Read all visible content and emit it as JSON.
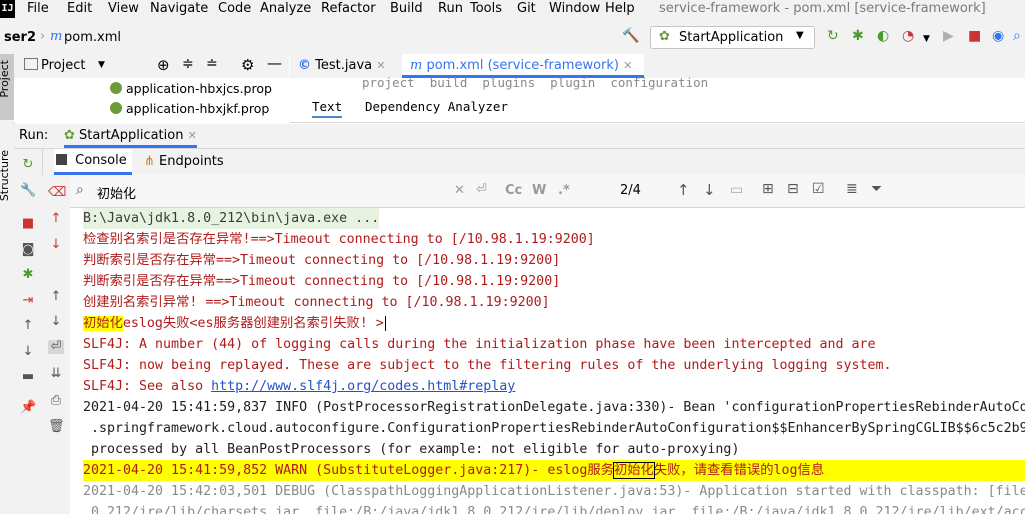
{
  "app": {
    "logo": "IJ",
    "window_title": "service-framework - pom.xml [service-framework]"
  },
  "menu": [
    "File",
    "Edit",
    "View",
    "Navigate",
    "Code",
    "Analyze",
    "Refactor",
    "Build",
    "Run",
    "Tools",
    "Git",
    "Window",
    "Help"
  ],
  "navbar": {
    "project_crumb": "ser2",
    "file_crumb": "pom.xml",
    "run_config": "StartApplication"
  },
  "left_strip": {
    "project_label": "Project",
    "structure_label": "Structure"
  },
  "project_panel": {
    "title": "Project",
    "files": [
      "application-hbxjcs.prop",
      "application-hbxjkf.prop"
    ]
  },
  "editor": {
    "tabs": [
      "Test.java",
      "pom.xml (service-framework)"
    ],
    "breadcrumbs": "project  build  plugins  plugin  configuration",
    "subtabs": [
      "Text",
      "Dependency Analyzer"
    ]
  },
  "run_panel": {
    "label": "Run:",
    "tab": "StartApplication",
    "tabs": [
      "Console",
      "Endpoints"
    ]
  },
  "search": {
    "value": "初始化",
    "match_count": "2/4",
    "case_label": "Cc",
    "word_label": "W",
    "regex_label": ".*"
  },
  "console": {
    "lines": [
      {
        "text": "B:\\Java\\jdk1.8.0_212\\bin\\java.exe ...",
        "style": "c-gray"
      },
      {
        "text": "检查别名索引是否存在异常!==>Timeout connecting to [/10.98.1.19:9200]",
        "style": "c-red"
      },
      {
        "text": "判断索引是否存在异常==>Timeout connecting to [/10.98.1.19:9200]",
        "style": "c-red"
      },
      {
        "text": "判断索引是否存在异常==>Timeout connecting to [/10.98.1.19:9200]",
        "style": "c-red"
      },
      {
        "text": "创建别名索引异常! ==>Timeout connecting to [/10.98.1.19:9200]",
        "style": "c-red"
      },
      {
        "text_hl": "初始化",
        "text": "eslog失败<es服务器创建别名索引失败! >",
        "style": "c-red"
      },
      {
        "text": "SLF4J: A number (44) of logging calls during the initialization phase have been intercepted and are",
        "style": "c-red"
      },
      {
        "text": "SLF4J: now being replayed. These are subject to the filtering rules of the underlying logging system.",
        "style": "c-red"
      },
      {
        "text": "SLF4J: See also ",
        "link": "http://www.slf4j.org/codes.html#replay",
        "style": "c-red"
      },
      {
        "text": "2021-04-20 15:41:59,837 INFO (PostProcessorRegistrationDelegate.java:330)- Bean 'configurationPropertiesRebinderAutoCo",
        "style": "c-black"
      },
      {
        "text": " .springframework.cloud.autoconfigure.ConfigurationPropertiesRebinderAutoConfiguration$$EnhancerBySpringCGLIB$$6c5c2b9",
        "style": "c-black"
      },
      {
        "text": " processed by all BeanPostProcessors (for example: not eligible for auto-proxying)",
        "style": "c-black"
      },
      {
        "pre": "2021-04-20 15:41:59,852 WARN (SubstituteLogger.java:217)- eslog服务",
        "text_hl": "初始化",
        "text": "失败，请查看错误的log信息",
        "style": "c-red"
      },
      {
        "text": "2021-04-20 15:42:03,501 DEBUG (ClasspathLoggingApplicationListener.java:53)- Application started with classpath: [file",
        "style": "c-dim"
      },
      {
        "text": "_0_212/jre/lib/charsets.jar, file:/B:/java/jdk1.8.0_212/jre/lib/deploy.jar, file:/B:/java/jdk1.8.0_212/jre/lib/ext/acc",
        "style": "c-dim"
      }
    ]
  },
  "colors": {
    "accent": "#3574f0",
    "error_text": "#b01b1b",
    "highlight": "#ffff00",
    "link": "#2850c8"
  }
}
